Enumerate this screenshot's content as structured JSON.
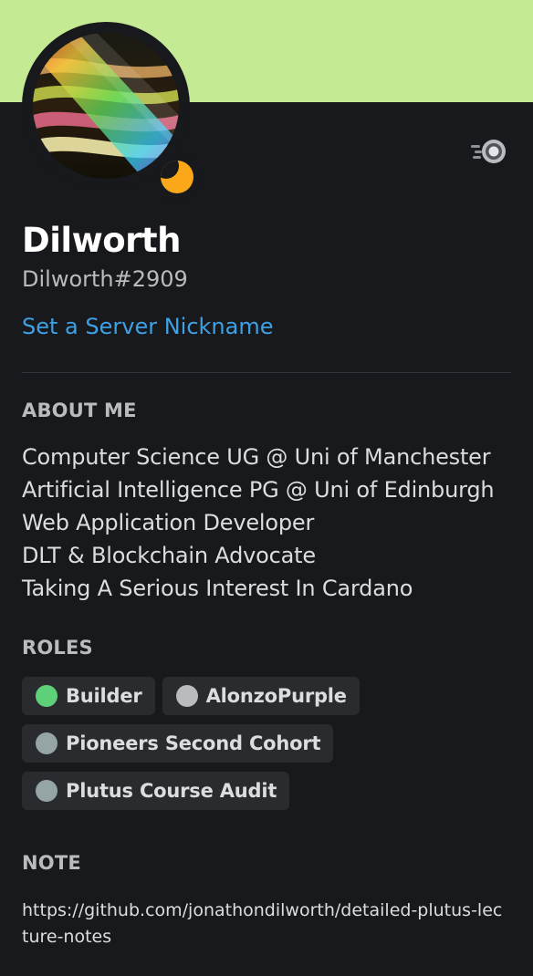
{
  "colors": {
    "banner": "#c4ea94",
    "background": "#18191c",
    "status_idle": "#faa81a",
    "link": "#3ea1e6"
  },
  "profile": {
    "display_name": "Dilworth",
    "tag": "Dilworth#2909",
    "nickname_link": "Set a Server Nickname",
    "status": "idle",
    "badge_icon": "nitro-boost-icon"
  },
  "about": {
    "title": "ABOUT ME",
    "lines": [
      "Computer Science UG @ Uni of Manchester",
      "Artificial Intelligence PG @ Uni of Edinburgh",
      "Web Application Developer",
      "DLT & Blockchain Advocate",
      "Taking A Serious Interest In Cardano"
    ]
  },
  "roles": {
    "title": "ROLES",
    "items": [
      {
        "name": "Builder",
        "color": "#5ed07a"
      },
      {
        "name": "AlonzoPurple",
        "color": "#b9bbbe"
      },
      {
        "name": "Pioneers Second Cohort",
        "color": "#95a5a6"
      },
      {
        "name": "Plutus Course Audit",
        "color": "#95a5a6"
      }
    ]
  },
  "note": {
    "title": "NOTE",
    "text": "https://github.com/jonathondilworth/detailed-plutus-lecture-notes"
  }
}
